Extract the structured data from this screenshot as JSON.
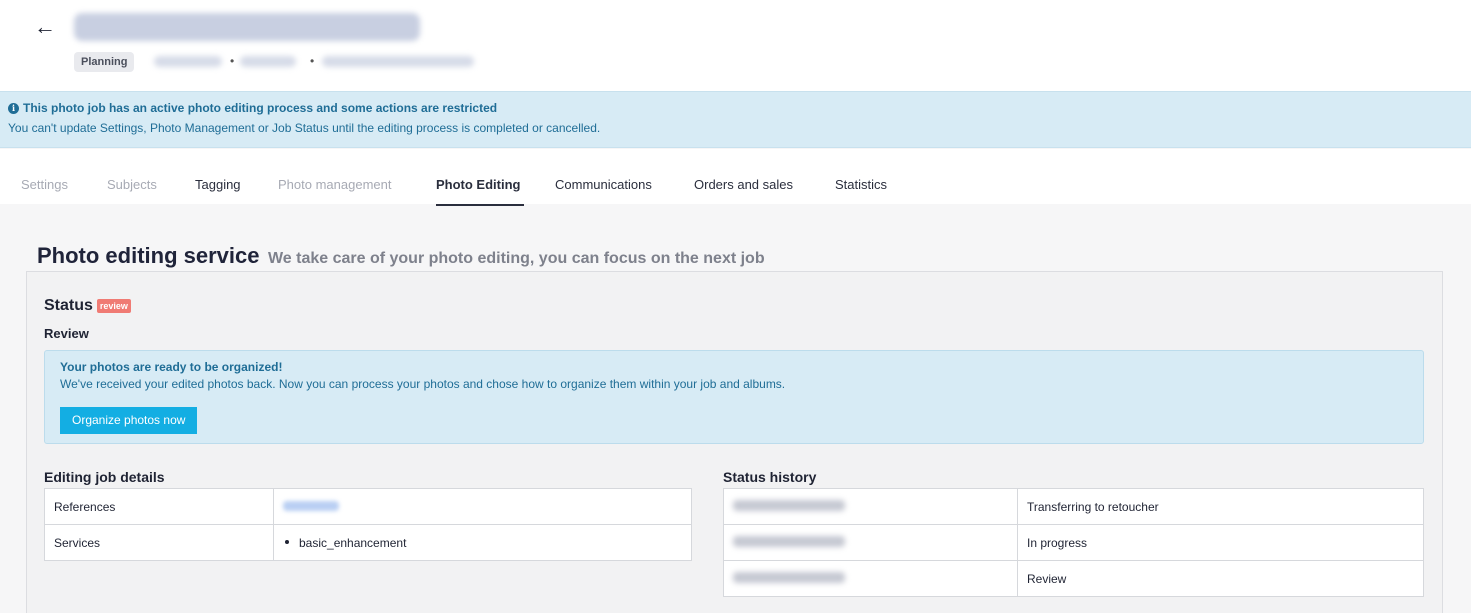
{
  "header": {
    "back_icon": "arrow-left-icon",
    "status_badge": "Planning"
  },
  "alert": {
    "icon": "info-icon",
    "title": "This photo job has an active photo editing process and some actions are restricted",
    "text": "You can't update Settings, Photo Management or Job Status until the editing process is completed or cancelled."
  },
  "tabs": [
    {
      "label": "Settings",
      "state": "disabled"
    },
    {
      "label": "Subjects",
      "state": "disabled"
    },
    {
      "label": "Tagging",
      "state": "enabled"
    },
    {
      "label": "Photo management",
      "state": "disabled"
    },
    {
      "label": "Photo Editing",
      "state": "active"
    },
    {
      "label": "Communications",
      "state": "enabled"
    },
    {
      "label": "Orders and sales",
      "state": "enabled"
    },
    {
      "label": "Statistics",
      "state": "enabled"
    }
  ],
  "section": {
    "title": "Photo editing service",
    "subtitle": "We take care of your photo editing, you can focus on the next job"
  },
  "status": {
    "label": "Status",
    "badge": "review",
    "badge_color": "#f07b74",
    "current": "Review"
  },
  "ready_alert": {
    "title": "Your photos are ready to be organized!",
    "text": "We've received your edited photos back. Now you can process your photos and chose how to organize them within your job and albums.",
    "button": "Organize photos now",
    "button_color": "#13aee3"
  },
  "details": {
    "title": "Editing job details",
    "rows": [
      {
        "label": "References"
      },
      {
        "label": "Services",
        "value": "basic_enhancement"
      }
    ]
  },
  "history": {
    "title": "Status history",
    "rows": [
      {
        "status": "Transferring to retoucher"
      },
      {
        "status": "In progress"
      },
      {
        "status": "Review"
      }
    ]
  }
}
